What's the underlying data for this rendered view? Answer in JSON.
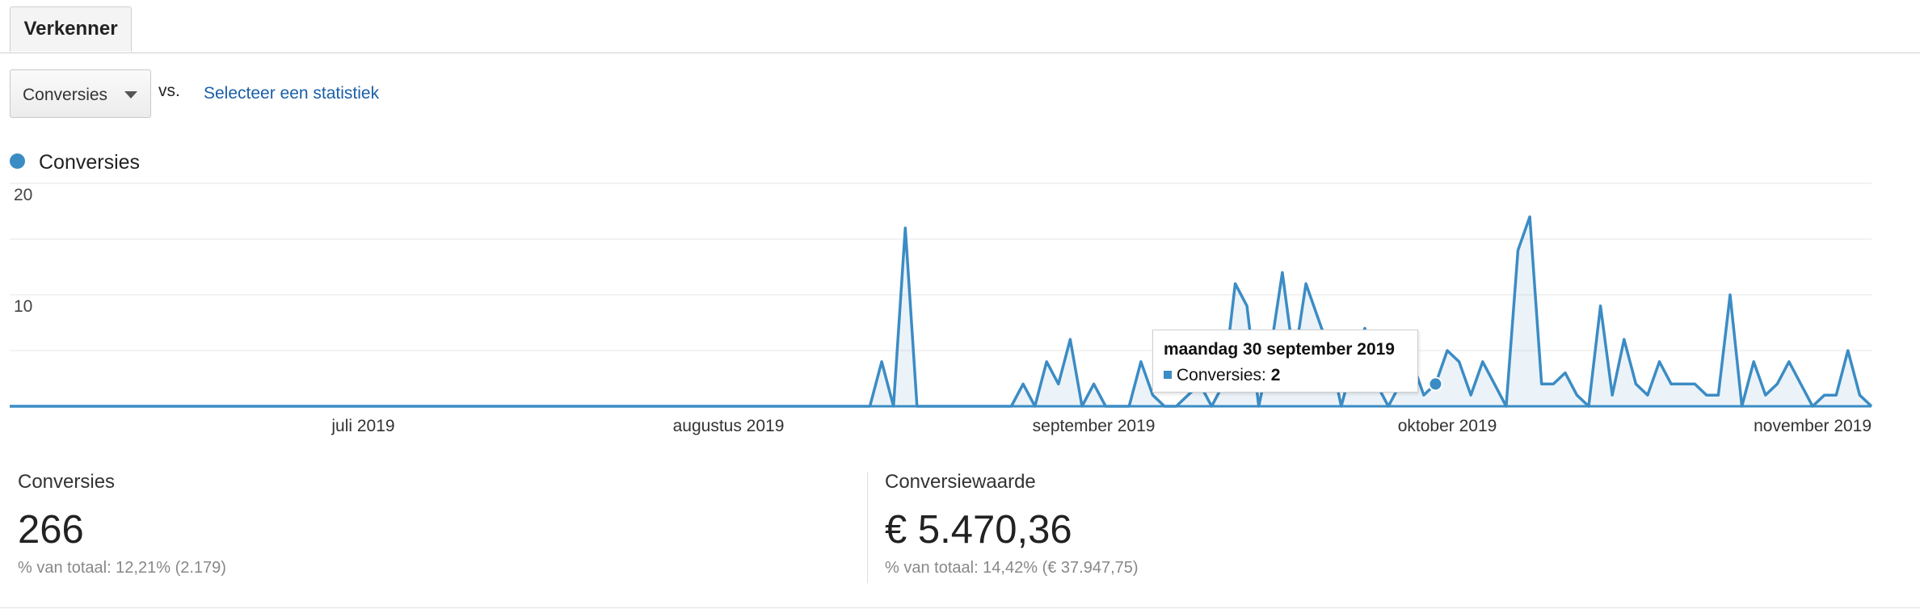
{
  "tabs": {
    "explorer": "Verkenner"
  },
  "metric_selector": {
    "selected": "Conversies",
    "vs_label": "vs.",
    "select_metric_link": "Selecteer een statistiek"
  },
  "legend": {
    "series_name": "Conversies",
    "color": "#3b8cc4"
  },
  "chart_data": {
    "type": "area",
    "series": [
      {
        "name": "Conversies",
        "color": "#3b8cc4",
        "values": [
          0,
          0,
          0,
          0,
          0,
          0,
          0,
          0,
          0,
          0,
          0,
          0,
          0,
          0,
          0,
          0,
          0,
          0,
          0,
          0,
          0,
          0,
          0,
          0,
          0,
          0,
          0,
          0,
          0,
          0,
          0,
          0,
          0,
          0,
          0,
          0,
          0,
          0,
          0,
          0,
          0,
          0,
          0,
          0,
          0,
          0,
          0,
          0,
          0,
          0,
          0,
          0,
          0,
          0,
          0,
          0,
          0,
          0,
          0,
          0,
          0,
          0,
          0,
          0,
          0,
          0,
          0,
          0,
          0,
          0,
          0,
          0,
          0,
          0,
          4,
          0,
          16,
          0,
          0,
          0,
          0,
          0,
          0,
          0,
          0,
          0,
          2,
          0,
          4,
          2,
          6,
          0,
          2,
          0,
          0,
          0,
          4,
          1,
          0,
          0,
          1,
          2,
          0,
          2,
          11,
          9,
          0,
          5,
          12,
          4,
          11,
          8,
          5,
          0,
          4,
          7,
          2,
          0,
          2,
          4,
          1,
          2,
          5,
          4,
          1,
          4,
          2,
          0,
          14,
          17,
          2,
          2,
          3,
          1,
          0,
          9,
          1,
          6,
          2,
          1,
          4,
          2,
          2,
          2,
          1,
          1,
          10,
          0,
          4,
          1,
          2,
          4,
          2,
          0,
          1,
          1,
          5,
          1,
          0
        ]
      }
    ],
    "x_labels": [
      "juli 2019",
      "augustus 2019",
      "september 2019",
      "oktober 2019",
      "november 2019"
    ],
    "y_ticks": [
      10,
      20
    ],
    "ylim": [
      0,
      20
    ],
    "grid": true
  },
  "tooltip": {
    "date": "maandag 30 september 2019",
    "metric_label": "Conversies:",
    "value": "2"
  },
  "scorecards": [
    {
      "label": "Conversies",
      "value": "266",
      "sub": "% van totaal: 12,21% (2.179)"
    },
    {
      "label": "Conversiewaarde",
      "value": "€ 5.470,36",
      "sub": "% van totaal: 14,42% (€ 37.947,75)"
    }
  ]
}
